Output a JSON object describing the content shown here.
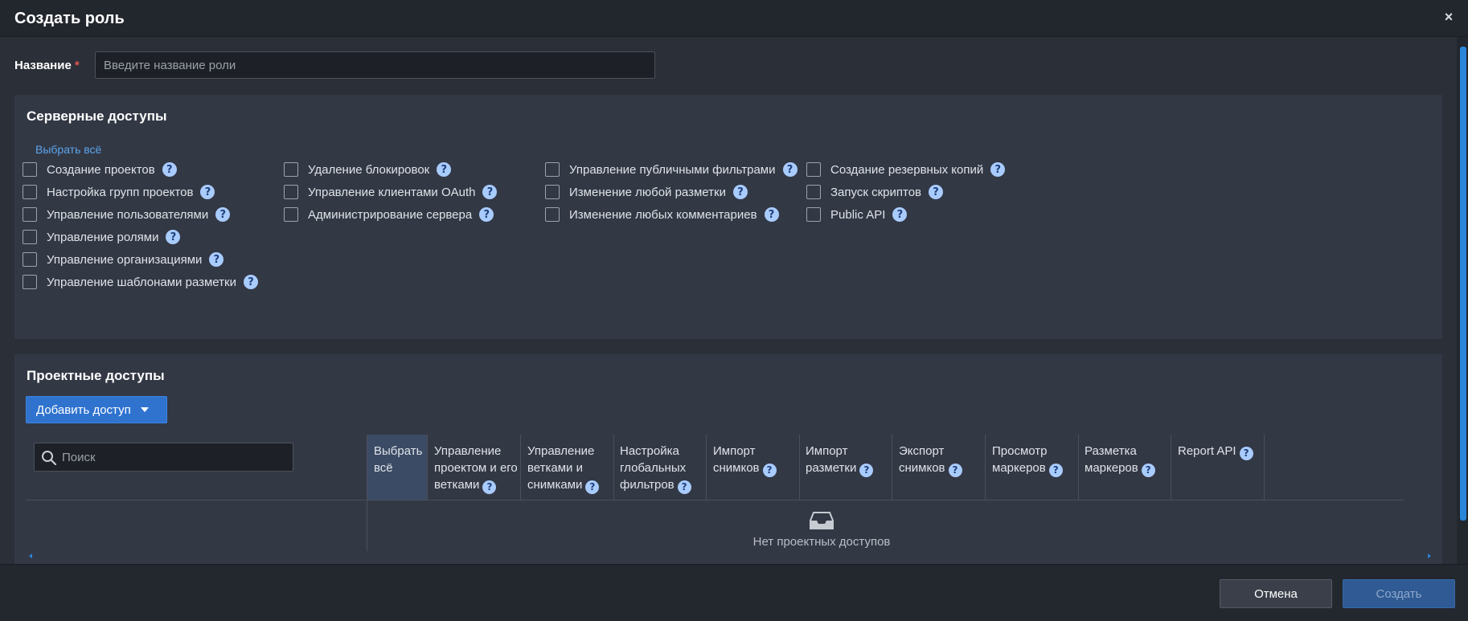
{
  "dialog": {
    "title": "Создать роль",
    "close_glyph": "×"
  },
  "name_field": {
    "label": "Название",
    "required_mark": "*",
    "placeholder": "Введите название роли",
    "value": ""
  },
  "server_access": {
    "title": "Серверные доступы",
    "select_all": "Выбрать всё",
    "help_glyph": "?",
    "columns": [
      [
        "Создание проектов",
        "Настройка групп проектов",
        "Управление пользователями",
        "Управление ролями",
        "Управление организациями",
        "Управление шаблонами разметки"
      ],
      [
        "Удаление блокировок",
        "Управление клиентами OAuth",
        "Администрирование сервера"
      ],
      [
        "Управление публичными фильтрами",
        "Изменение любой разметки",
        "Изменение любых комментариев"
      ],
      [
        "Создание резервных копий",
        "Запуск скриптов",
        "Public API"
      ]
    ]
  },
  "project_access": {
    "title": "Проектные доступы",
    "add_button": "Добавить доступ",
    "search_placeholder": "Поиск",
    "select_all_column": "Выбрать всё",
    "columns": [
      {
        "lines": [
          "Управление",
          "проектом и его",
          "ветками"
        ],
        "help": true
      },
      {
        "lines": [
          "Управление",
          "ветками и",
          "снимками"
        ],
        "help": true
      },
      {
        "lines": [
          "Настройка",
          "глобальных",
          "фильтров"
        ],
        "help": true
      },
      {
        "lines": [
          "Импорт",
          "снимков"
        ],
        "help": true
      },
      {
        "lines": [
          "Импорт",
          "разметки"
        ],
        "help": true
      },
      {
        "lines": [
          "Экспорт",
          "снимков"
        ],
        "help": true
      },
      {
        "lines": [
          "Просмотр",
          "маркеров"
        ],
        "help": true
      },
      {
        "lines": [
          "Разметка",
          "маркеров"
        ],
        "help": true
      },
      {
        "lines": [
          "Report API"
        ],
        "help": true
      }
    ],
    "empty_text": "Нет проектных доступов",
    "empty_icon": "inbox-icon"
  },
  "footer": {
    "cancel": "Отмена",
    "create": "Создать"
  },
  "colors": {
    "accent": "#2f73cf",
    "help_icon": "#a9ccff",
    "required": "#e05555",
    "link": "#5aa5ec"
  }
}
